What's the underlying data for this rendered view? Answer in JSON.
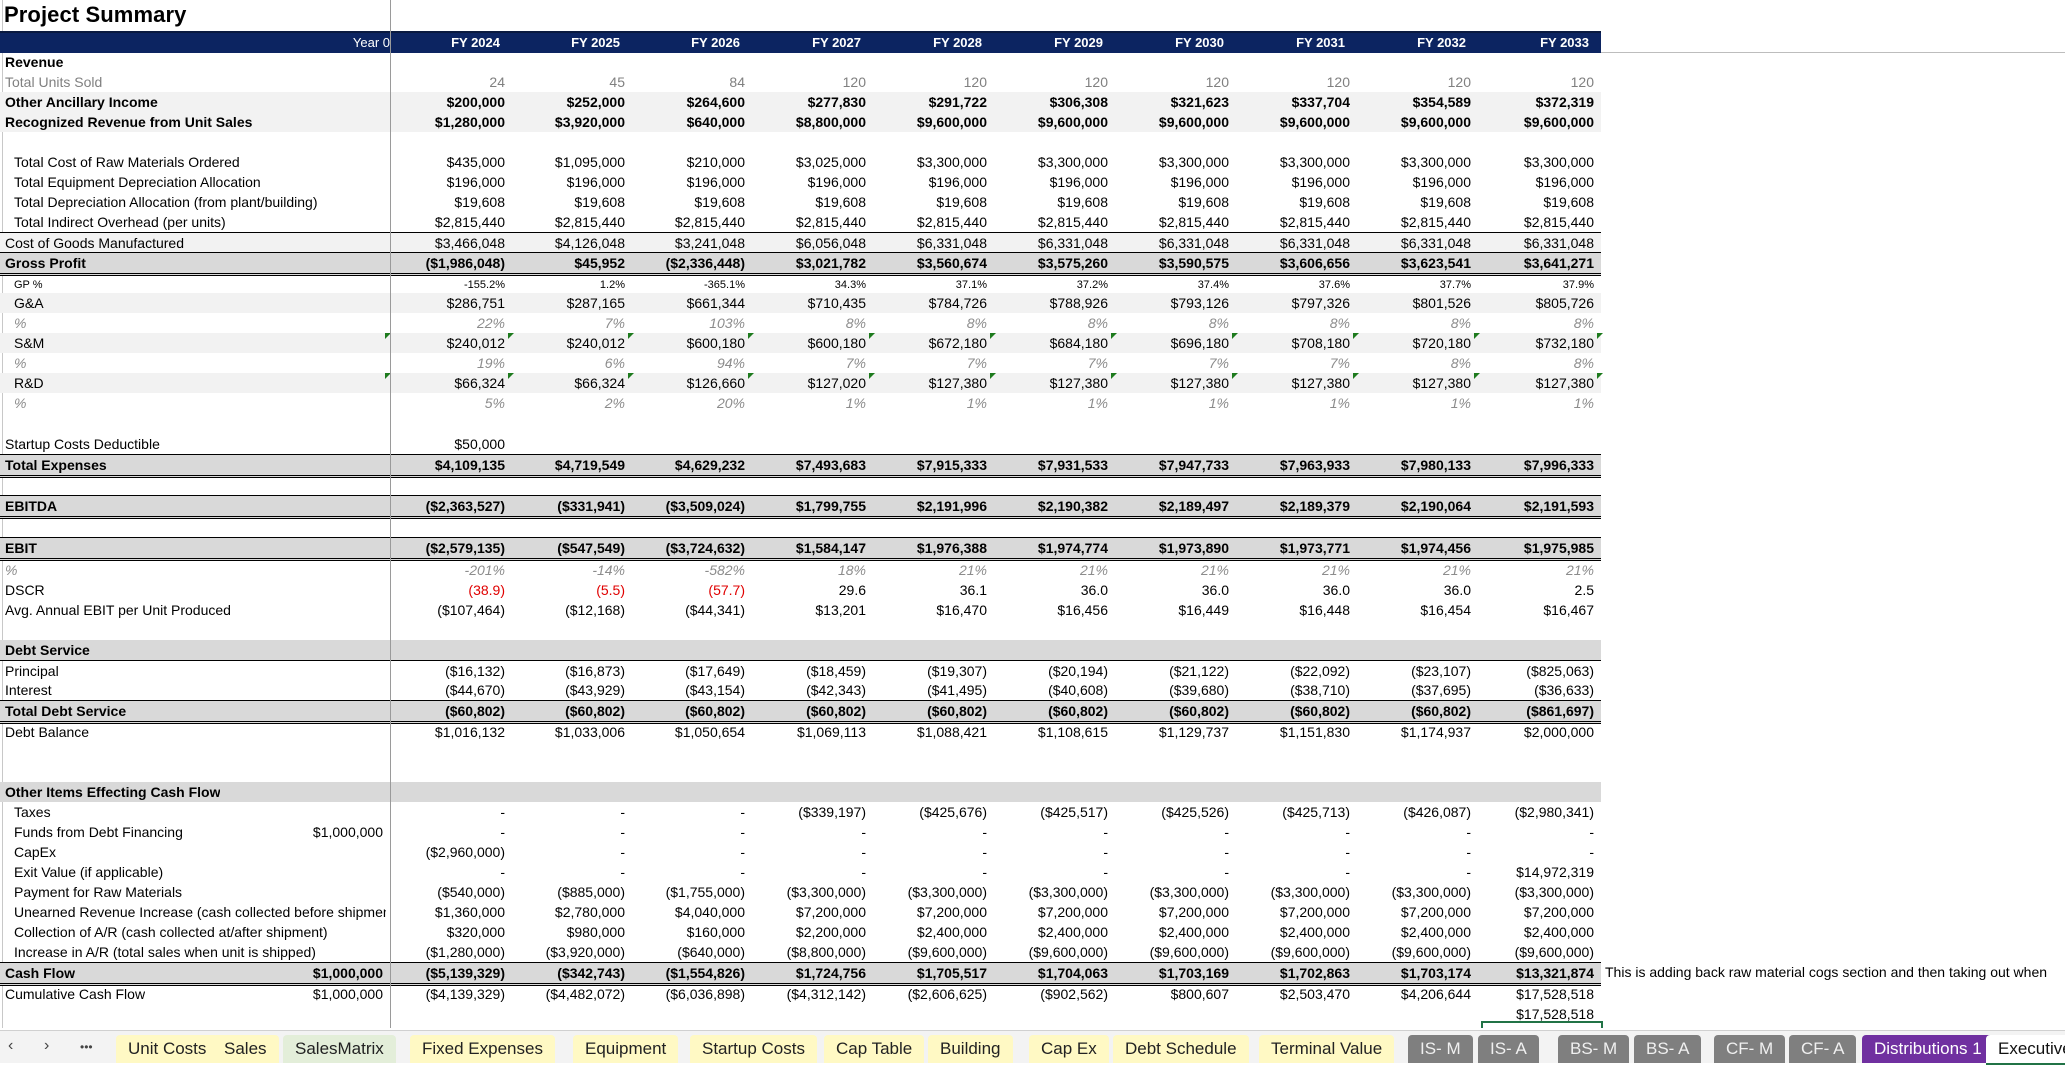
{
  "sheet": {
    "title": "Project Summary",
    "header": {
      "year0_label": "Year 0",
      "years": [
        "FY 2024",
        "FY 2025",
        "FY 2026",
        "FY 2027",
        "FY 2028",
        "FY 2029",
        "FY 2030",
        "FY 2031",
        "FY 2032",
        "FY 2033"
      ]
    },
    "rows": {
      "revenue": {
        "label": "Revenue"
      },
      "units": {
        "label": "Total Units Sold",
        "values": [
          "24",
          "45",
          "84",
          "120",
          "120",
          "120",
          "120",
          "120",
          "120",
          "120"
        ]
      },
      "ancillary": {
        "label": "Other Ancillary Income",
        "values": [
          "$200,000",
          "$252,000",
          "$264,600",
          "$277,830",
          "$291,722",
          "$306,308",
          "$321,623",
          "$337,704",
          "$354,589",
          "$372,319"
        ]
      },
      "recognized": {
        "label": "Recognized Revenue from Unit Sales",
        "values": [
          "$1,280,000",
          "$3,920,000",
          "$640,000",
          "$8,800,000",
          "$9,600,000",
          "$9,600,000",
          "$9,600,000",
          "$9,600,000",
          "$9,600,000",
          "$9,600,000"
        ]
      },
      "raw_materials": {
        "label": "Total Cost of Raw Materials Ordered",
        "values": [
          "$435,000",
          "$1,095,000",
          "$210,000",
          "$3,025,000",
          "$3,300,000",
          "$3,300,000",
          "$3,300,000",
          "$3,300,000",
          "$3,300,000",
          "$3,300,000"
        ]
      },
      "equip_dep": {
        "label": "Total Equipment Depreciation Allocation",
        "values": [
          "$196,000",
          "$196,000",
          "$196,000",
          "$196,000",
          "$196,000",
          "$196,000",
          "$196,000",
          "$196,000",
          "$196,000",
          "$196,000"
        ]
      },
      "plant_dep": {
        "label": "Total Depreciation Allocation (from plant/building)",
        "values": [
          "$19,608",
          "$19,608",
          "$19,608",
          "$19,608",
          "$19,608",
          "$19,608",
          "$19,608",
          "$19,608",
          "$19,608",
          "$19,608"
        ]
      },
      "overhead": {
        "label": "Total Indirect Overhead (per units)",
        "values": [
          "$2,815,440",
          "$2,815,440",
          "$2,815,440",
          "$2,815,440",
          "$2,815,440",
          "$2,815,440",
          "$2,815,440",
          "$2,815,440",
          "$2,815,440",
          "$2,815,440"
        ]
      },
      "cogm": {
        "label": "Cost of Goods Manufactured",
        "values": [
          "$3,466,048",
          "$4,126,048",
          "$3,241,048",
          "$6,056,048",
          "$6,331,048",
          "$6,331,048",
          "$6,331,048",
          "$6,331,048",
          "$6,331,048",
          "$6,331,048"
        ]
      },
      "gross_profit": {
        "label": "Gross Profit",
        "values": [
          "($1,986,048)",
          "$45,952",
          "($2,336,448)",
          "$3,021,782",
          "$3,560,674",
          "$3,575,260",
          "$3,590,575",
          "$3,606,656",
          "$3,623,541",
          "$3,641,271"
        ]
      },
      "gp_pct": {
        "label": "GP %",
        "values": [
          "-155.2%",
          "1.2%",
          "-365.1%",
          "34.3%",
          "37.1%",
          "37.2%",
          "37.4%",
          "37.6%",
          "37.7%",
          "37.9%"
        ]
      },
      "ga": {
        "label": "G&A",
        "values": [
          "$286,751",
          "$287,165",
          "$661,344",
          "$710,435",
          "$784,726",
          "$788,926",
          "$793,126",
          "$797,326",
          "$801,526",
          "$805,726"
        ]
      },
      "ga_pct": {
        "label": "%",
        "values": [
          "22%",
          "7%",
          "103%",
          "8%",
          "8%",
          "8%",
          "8%",
          "8%",
          "8%",
          "8%"
        ]
      },
      "sm": {
        "label": "S&M",
        "values": [
          "$240,012",
          "$240,012",
          "$600,180",
          "$600,180",
          "$672,180",
          "$684,180",
          "$696,180",
          "$708,180",
          "$720,180",
          "$732,180"
        ]
      },
      "sm_pct": {
        "label": "%",
        "values": [
          "19%",
          "6%",
          "94%",
          "7%",
          "7%",
          "7%",
          "7%",
          "7%",
          "8%",
          "8%"
        ]
      },
      "rd": {
        "label": "R&D",
        "values": [
          "$66,324",
          "$66,324",
          "$126,660",
          "$127,020",
          "$127,380",
          "$127,380",
          "$127,380",
          "$127,380",
          "$127,380",
          "$127,380"
        ]
      },
      "rd_pct": {
        "label": "%",
        "values": [
          "5%",
          "2%",
          "20%",
          "1%",
          "1%",
          "1%",
          "1%",
          "1%",
          "1%",
          "1%"
        ]
      },
      "startup": {
        "label": "Startup Costs Deductible",
        "values": [
          "$50,000",
          "",
          "",
          "",
          "",
          "",
          "",
          "",
          "",
          ""
        ]
      },
      "total_expenses": {
        "label": "Total Expenses",
        "values": [
          "$4,109,135",
          "$4,719,549",
          "$4,629,232",
          "$7,493,683",
          "$7,915,333",
          "$7,931,533",
          "$7,947,733",
          "$7,963,933",
          "$7,980,133",
          "$7,996,333"
        ]
      },
      "ebitda": {
        "label": "EBITDA",
        "values": [
          "($2,363,527)",
          "($331,941)",
          "($3,509,024)",
          "$1,799,755",
          "$2,191,996",
          "$2,190,382",
          "$2,189,497",
          "$2,189,379",
          "$2,190,064",
          "$2,191,593"
        ]
      },
      "ebit": {
        "label": "EBIT",
        "values": [
          "($2,579,135)",
          "($547,549)",
          "($3,724,632)",
          "$1,584,147",
          "$1,976,388",
          "$1,974,774",
          "$1,973,890",
          "$1,973,771",
          "$1,974,456",
          "$1,975,985"
        ]
      },
      "ebit_pct": {
        "label": "%",
        "values": [
          "-201%",
          "-14%",
          "-582%",
          "18%",
          "21%",
          "21%",
          "21%",
          "21%",
          "21%",
          "21%"
        ]
      },
      "dscr": {
        "label": "DSCR",
        "values": [
          "(38.9)",
          "(5.5)",
          "(57.7)",
          "29.6",
          "36.1",
          "36.0",
          "36.0",
          "36.0",
          "36.0",
          "2.5"
        ]
      },
      "ebit_per_unit": {
        "label": "Avg. Annual EBIT per Unit Produced",
        "values": [
          "($107,464)",
          "($12,168)",
          "($44,341)",
          "$13,201",
          "$16,470",
          "$16,456",
          "$16,449",
          "$16,448",
          "$16,454",
          "$16,467"
        ]
      },
      "debt_service": {
        "label": "Debt Service"
      },
      "principal": {
        "label": "Principal",
        "values": [
          "($16,132)",
          "($16,873)",
          "($17,649)",
          "($18,459)",
          "($19,307)",
          "($20,194)",
          "($21,122)",
          "($22,092)",
          "($23,107)",
          "($825,063)"
        ]
      },
      "interest": {
        "label": "Interest",
        "values": [
          "($44,670)",
          "($43,929)",
          "($43,154)",
          "($42,343)",
          "($41,495)",
          "($40,608)",
          "($39,680)",
          "($38,710)",
          "($37,695)",
          "($36,633)"
        ]
      },
      "total_debt": {
        "label": "Total Debt Service",
        "values": [
          "($60,802)",
          "($60,802)",
          "($60,802)",
          "($60,802)",
          "($60,802)",
          "($60,802)",
          "($60,802)",
          "($60,802)",
          "($60,802)",
          "($861,697)"
        ]
      },
      "debt_balance": {
        "label": "Debt Balance",
        "values": [
          "$1,016,132",
          "$1,033,006",
          "$1,050,654",
          "$1,069,113",
          "$1,088,421",
          "$1,108,615",
          "$1,129,737",
          "$1,151,830",
          "$1,174,937",
          "$2,000,000"
        ]
      },
      "other_items": {
        "label": "Other Items Effecting Cash Flow"
      },
      "taxes": {
        "label": "Taxes",
        "values": [
          "-",
          "-",
          "-",
          "($339,197)",
          "($425,676)",
          "($425,517)",
          "($425,526)",
          "($425,713)",
          "($426,087)",
          "($2,980,341)"
        ]
      },
      "debt_funds": {
        "label": "Funds from Debt Financing",
        "year0": "$1,000,000",
        "values": [
          "-",
          "-",
          "-",
          "-",
          "-",
          "-",
          "-",
          "-",
          "-",
          "-"
        ]
      },
      "capex": {
        "label": "CapEx",
        "values": [
          "($2,960,000)",
          "-",
          "-",
          "-",
          "-",
          "-",
          "-",
          "-",
          "-",
          "-"
        ]
      },
      "exit_value": {
        "label": "Exit Value (if applicable)",
        "values": [
          "-",
          "-",
          "-",
          "-",
          "-",
          "-",
          "-",
          "-",
          "-",
          "$14,972,319"
        ]
      },
      "raw_payment": {
        "label": "Payment for Raw Materials",
        "values": [
          "($540,000)",
          "($885,000)",
          "($1,755,000)",
          "($3,300,000)",
          "($3,300,000)",
          "($3,300,000)",
          "($3,300,000)",
          "($3,300,000)",
          "($3,300,000)",
          "($3,300,000)"
        ]
      },
      "unearned": {
        "label": "Unearned Revenue Increase (cash collected before shipment)",
        "values": [
          "$1,360,000",
          "$2,780,000",
          "$4,040,000",
          "$7,200,000",
          "$7,200,000",
          "$7,200,000",
          "$7,200,000",
          "$7,200,000",
          "$7,200,000",
          "$7,200,000"
        ]
      },
      "ar_collect": {
        "label": "Collection of A/R (cash collected at/after shipment)",
        "values": [
          "$320,000",
          "$980,000",
          "$160,000",
          "$2,200,000",
          "$2,400,000",
          "$2,400,000",
          "$2,400,000",
          "$2,400,000",
          "$2,400,000",
          "$2,400,000"
        ]
      },
      "ar_increase": {
        "label": "Increase in A/R (total sales when unit is shipped)",
        "values": [
          "($1,280,000)",
          "($3,920,000)",
          "($640,000)",
          "($8,800,000)",
          "($9,600,000)",
          "($9,600,000)",
          "($9,600,000)",
          "($9,600,000)",
          "($9,600,000)",
          "($9,600,000)"
        ]
      },
      "cash_flow": {
        "label": "Cash Flow",
        "year0": "$1,000,000",
        "values": [
          "($5,139,329)",
          "($342,743)",
          "($1,554,826)",
          "$1,724,756",
          "$1,705,517",
          "$1,704,063",
          "$1,703,169",
          "$1,702,863",
          "$1,703,174",
          "$13,321,874"
        ]
      },
      "cum_cash": {
        "label": "Cumulative Cash Flow",
        "year0": "$1,000,000",
        "values": [
          "($4,139,329)",
          "($4,482,072)",
          "($6,036,898)",
          "($4,312,142)",
          "($2,606,625)",
          "($902,562)",
          "$800,607",
          "$2,503,470",
          "$4,206,644",
          "$17,528,518"
        ]
      },
      "extra_cell": "$17,528,518"
    },
    "note": "This is adding back raw material cogs section and then taking out when"
  },
  "tabs": {
    "nav": {
      "prev": "‹",
      "next": "›",
      "more": "•••"
    },
    "items": [
      {
        "label": "Unit Costs",
        "style": "y"
      },
      {
        "label": "Sales",
        "style": "y"
      },
      {
        "label": "SalesMatrix",
        "style": "g"
      },
      {
        "label": "Fixed Expenses",
        "style": "y"
      },
      {
        "label": "Equipment",
        "style": "y"
      },
      {
        "label": "Startup Costs",
        "style": "y"
      },
      {
        "label": "Cap Table",
        "style": "y"
      },
      {
        "label": "Building",
        "style": "y"
      },
      {
        "label": "Cap Ex",
        "style": "y"
      },
      {
        "label": "Debt Schedule",
        "style": "y"
      },
      {
        "label": "Terminal Value",
        "style": "y"
      },
      {
        "label": "IS- M",
        "style": "d"
      },
      {
        "label": "IS- A",
        "style": "d"
      },
      {
        "label": "BS- M",
        "style": "d"
      },
      {
        "label": "BS- A",
        "style": "d"
      },
      {
        "label": "CF- M",
        "style": "d"
      },
      {
        "label": "CF- A",
        "style": "d"
      },
      {
        "label": "Distributions 1",
        "style": "p"
      },
      {
        "label": "Executive Summary",
        "style": "a"
      }
    ]
  }
}
